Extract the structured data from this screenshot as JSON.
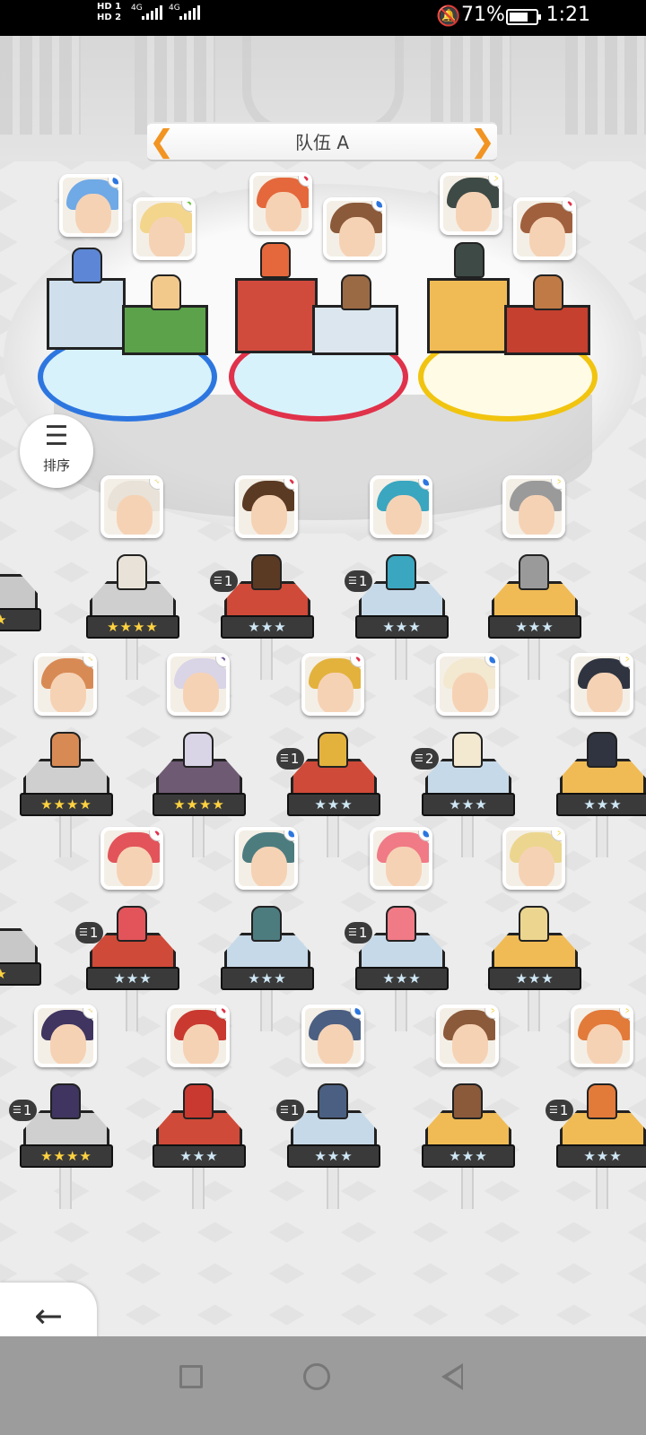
{
  "status_bar": {
    "network_top": "HD 1",
    "network_bottom": "HD 2",
    "signal_1": "4G",
    "signal_2": "4G",
    "mute_icon": "bell-off-icon",
    "battery_percent": "71%",
    "battery_level": 0.71,
    "time": "1:21"
  },
  "team": {
    "title": "队伍 A",
    "prev_icon": "chevron-left-icon",
    "next_icon": "chevron-right-icon",
    "slots": [
      {
        "element": "water",
        "portrait_color": "#6fa9e6"
      },
      {
        "element": "grass",
        "portrait_color": "#f3d58c"
      },
      {
        "element": "fire",
        "portrait_color": "#e4683b"
      },
      {
        "element": "water",
        "portrait_color": "#8a5a3a"
      },
      {
        "element": "thunder",
        "portrait_color": "#3e4a46"
      },
      {
        "element": "fire",
        "portrait_color": "#a0603d"
      }
    ]
  },
  "sort_button": {
    "label": "排序",
    "icon": "sort-icon"
  },
  "back_button": {
    "label": "返回",
    "icon": "arrow-left-icon"
  },
  "roster": [
    {
      "stars": "★★★★",
      "rarity": "gold",
      "element": "light",
      "copies": "",
      "portrait_color": "#e8e2d8"
    },
    {
      "stars": "★★★",
      "rarity": "silver",
      "element": "fire",
      "copies": "1",
      "portrait_color": "#5b3a24"
    },
    {
      "stars": "★★★",
      "rarity": "silver",
      "element": "water",
      "copies": "1",
      "portrait_color": "#3aa6c0"
    },
    {
      "stars": "★★★",
      "rarity": "silver",
      "element": "thunder",
      "copies": "",
      "portrait_color": "#9a9a9a"
    },
    {
      "stars": "★★★★",
      "rarity": "gold",
      "element": "light",
      "copies": "",
      "portrait_color": "#d88a55"
    },
    {
      "stars": "★★★★",
      "rarity": "gold",
      "element": "dark",
      "copies": "",
      "portrait_color": "#d9d4e6"
    },
    {
      "stars": "★★★",
      "rarity": "silver",
      "element": "fire",
      "copies": "1",
      "portrait_color": "#e3b23d"
    },
    {
      "stars": "★★★",
      "rarity": "silver",
      "element": "water",
      "copies": "2",
      "portrait_color": "#f3e8d0"
    },
    {
      "stars": "★★★",
      "rarity": "silver",
      "element": "thunder",
      "copies": "",
      "portrait_color": "#2f3440"
    },
    {
      "stars": "★★★",
      "rarity": "silver",
      "element": "fire",
      "copies": "1",
      "portrait_color": "#e2545a"
    },
    {
      "stars": "★★★",
      "rarity": "silver",
      "element": "water",
      "copies": "",
      "portrait_color": "#4d7c7f"
    },
    {
      "stars": "★★★",
      "rarity": "silver",
      "element": "water",
      "copies": "1",
      "portrait_color": "#f07a86"
    },
    {
      "stars": "★★★",
      "rarity": "silver",
      "element": "thunder",
      "copies": "",
      "portrait_color": "#ecd68f"
    },
    {
      "stars": "★★★★",
      "rarity": "gold",
      "element": "light",
      "copies": "1",
      "portrait_color": "#3f3560"
    },
    {
      "stars": "★★★",
      "rarity": "silver",
      "element": "fire",
      "copies": "",
      "portrait_color": "#c9392f"
    },
    {
      "stars": "★★★",
      "rarity": "silver",
      "element": "water",
      "copies": "1",
      "portrait_color": "#4b5f82"
    },
    {
      "stars": "★★★",
      "rarity": "silver",
      "element": "thunder",
      "copies": "",
      "portrait_color": "#8b5a3b"
    },
    {
      "stars": "★★★",
      "rarity": "silver",
      "element": "thunder",
      "copies": "1",
      "portrait_color": "#e27a3a"
    }
  ],
  "edge_stars": {
    "row1_left": "★★",
    "row3_left": "★★"
  },
  "colors": {
    "accent_orange": "#f29422",
    "fire": "#e0324a",
    "water": "#2d76e0",
    "thunder": "#f1c40f",
    "grass": "#6abf3a",
    "dark": "#6a4c93",
    "light": "#e6cf6a"
  },
  "nav_bar": {
    "recent_icon": "square-icon",
    "home_icon": "circle-icon",
    "back_icon": "triangle-back-icon"
  }
}
